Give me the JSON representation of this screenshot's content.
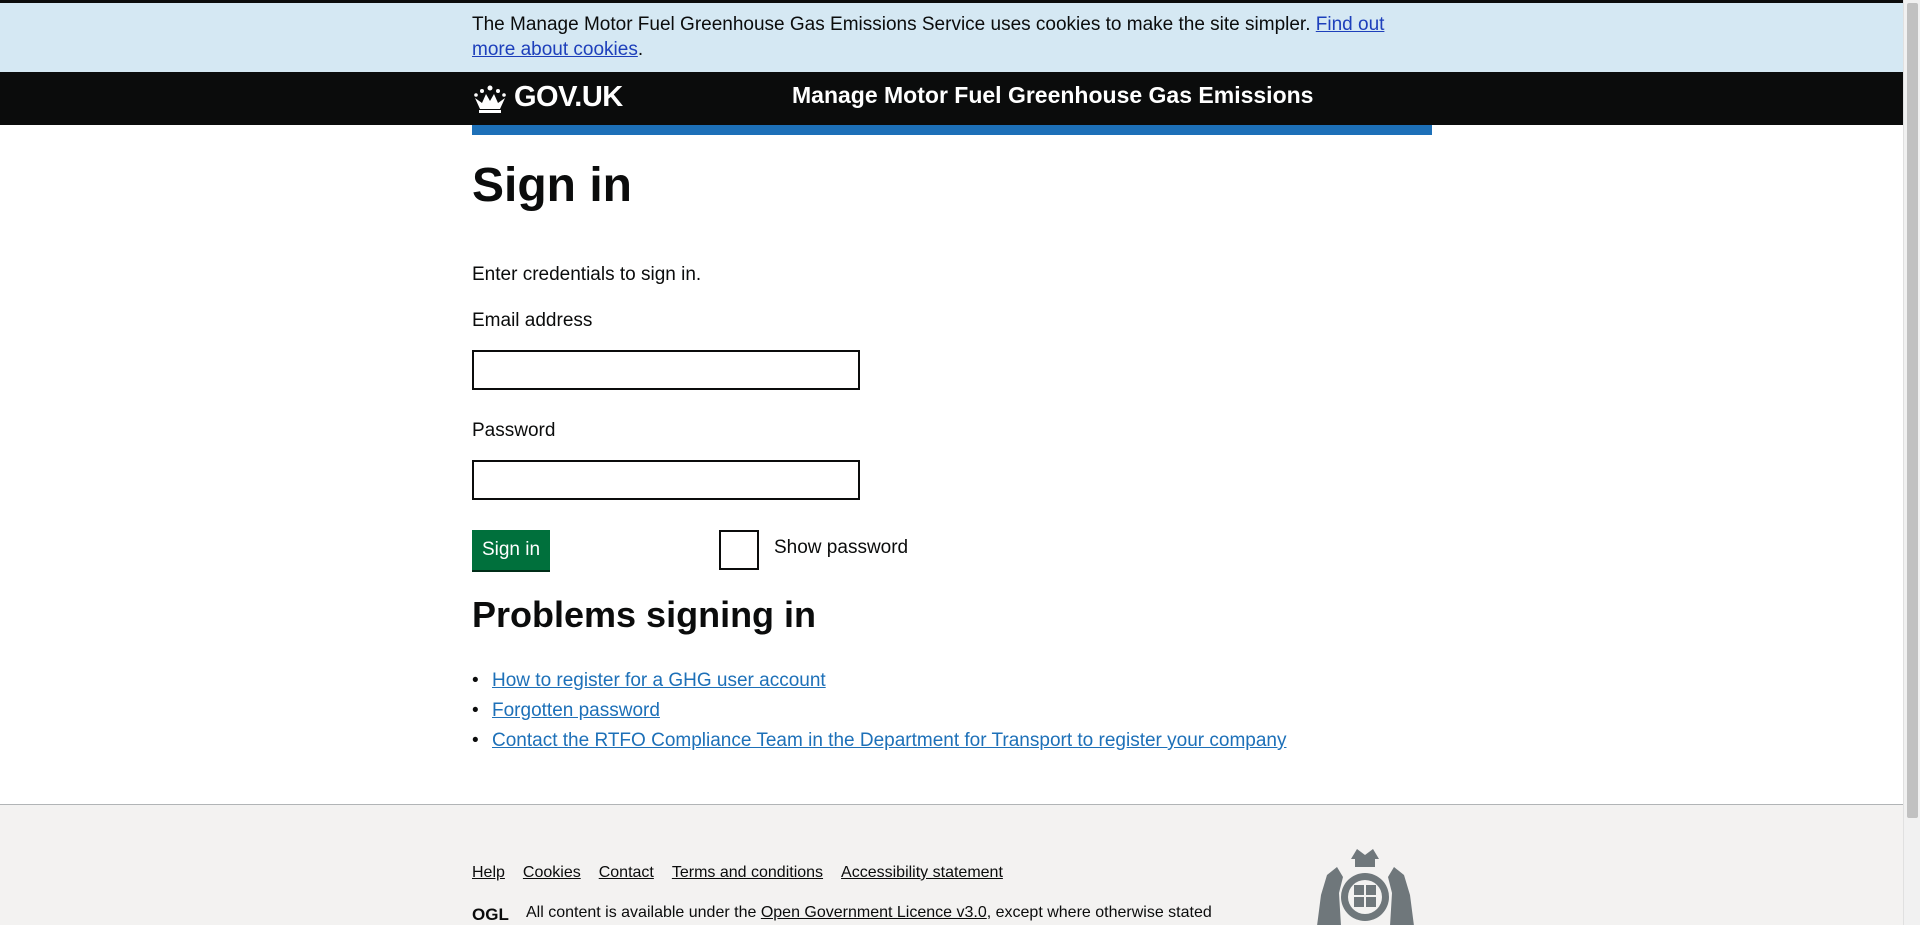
{
  "cookie_banner": {
    "text": "The Manage Motor Fuel Greenhouse Gas Emissions Service uses cookies to make the site simpler. ",
    "link": "Find out more about cookies",
    "suffix": "."
  },
  "header": {
    "logo_text": "GOV.UK",
    "service_name": "Manage Motor Fuel Greenhouse Gas Emissions"
  },
  "main": {
    "title": "Sign in",
    "lead": "Enter credentials to sign in.",
    "email_label": "Email address",
    "email_value": "",
    "password_label": "Password",
    "password_value": "",
    "signin_button": "Sign in",
    "show_password_label": "Show password"
  },
  "problems": {
    "heading": "Problems signing in",
    "links": [
      "How to register for a GHG user account",
      "Forgotten password",
      "Contact the RTFO Compliance Team in the Department for Transport to register your company"
    ]
  },
  "footer": {
    "links": [
      "Help",
      "Cookies",
      "Contact",
      "Terms and conditions",
      "Accessibility statement"
    ],
    "licence_prefix": "All content is available under the ",
    "licence_link": "Open Government Licence v3.0",
    "licence_suffix": ", except where otherwise stated",
    "ogl_logo": "OGL"
  },
  "colors": {
    "cookie_banner_bg": "#d5e8f3",
    "header_bg": "#0b0c0c",
    "accent_blue": "#1d70b8",
    "button_green": "#00703c",
    "footer_bg": "#f3f2f1"
  }
}
